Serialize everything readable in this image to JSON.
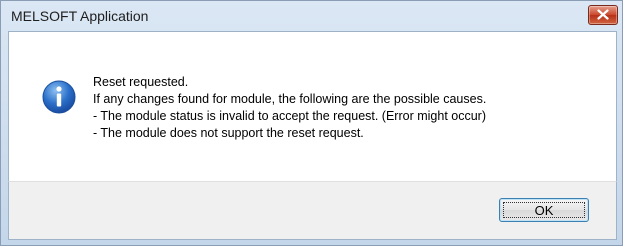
{
  "window": {
    "title": "MELSOFT Application"
  },
  "icon": {
    "name": "info-icon",
    "color": "#2a6fc9"
  },
  "message": {
    "lines": [
      "Reset requested.",
      "If any changes found for module, the following are the possible causes.",
      "- The module status is invalid to accept the request. (Error might occur)",
      "- The module does not support the reset request."
    ]
  },
  "buttons": {
    "ok_label": "OK",
    "close_icon": "close-icon"
  },
  "colors": {
    "close_button": "#c9472a",
    "title_bar": "#c4d6ea"
  }
}
